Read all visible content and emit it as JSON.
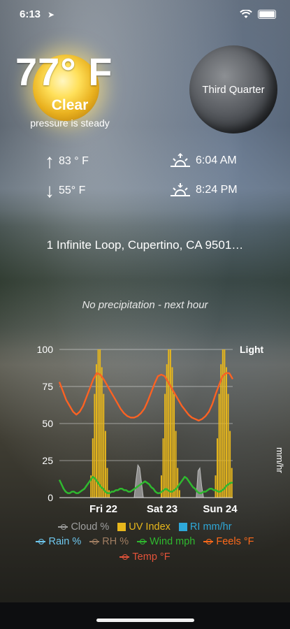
{
  "status_bar": {
    "time": "6:13",
    "location_icon": "arrow-icon",
    "wifi_icon": "wifi-icon",
    "battery_icon": "battery-icon"
  },
  "current": {
    "temperature": "77° F",
    "condition": "Clear",
    "pressure": "pressure is steady"
  },
  "moon": {
    "phase": "Third Quarter"
  },
  "high": {
    "value": "83 ° F"
  },
  "low": {
    "value": "55° F"
  },
  "sunrise": {
    "time": "6:04 AM"
  },
  "sunset": {
    "time": "8:24 PM"
  },
  "address": "1 Infinite Loop, Cupertino, CA 9501…",
  "precip_note": "No precipitation - next hour",
  "chart_data": {
    "type": "bar+line",
    "categories": [
      "Fri 22",
      "Sat 23",
      "Sun 24"
    ],
    "y_ticks": [
      0,
      25,
      50,
      75,
      100
    ],
    "ylim": [
      0,
      100
    ],
    "right_labels": {
      "top": "Light",
      "unit": "mm/hr"
    },
    "series": [
      {
        "name": "Cloud %",
        "type": "area",
        "color": "#a0a0a0",
        "values": [
          0,
          0,
          0,
          0,
          0,
          0,
          0,
          0,
          0,
          0,
          0,
          0,
          0,
          0,
          0,
          0,
          0,
          0,
          0,
          0,
          0,
          0,
          0,
          0,
          0,
          0,
          0,
          0,
          0,
          0,
          0,
          0,
          0,
          0,
          0,
          0,
          0,
          0,
          0,
          0,
          0,
          0,
          12,
          22,
          20,
          10,
          0,
          0,
          0,
          0,
          0,
          0,
          0,
          0,
          0,
          0,
          0,
          0,
          0,
          0,
          0,
          0,
          0,
          0,
          0,
          0,
          0,
          0,
          0,
          0,
          0,
          0,
          0,
          0,
          0,
          0,
          18,
          20,
          8,
          0,
          0,
          0,
          0,
          0,
          0,
          0,
          0,
          0,
          0,
          0,
          0,
          0,
          0,
          0,
          0,
          0
        ]
      },
      {
        "name": "UV Index",
        "type": "bar",
        "color": "#e8b71c",
        "values": [
          0,
          0,
          0,
          0,
          0,
          0,
          0,
          0,
          0,
          0,
          0,
          0,
          0,
          0,
          0,
          0,
          0,
          15,
          40,
          70,
          90,
          100,
          100,
          88,
          70,
          45,
          20,
          5,
          0,
          0,
          0,
          0,
          0,
          0,
          0,
          0,
          0,
          0,
          0,
          0,
          0,
          0,
          0,
          0,
          0,
          0,
          0,
          0,
          0,
          0,
          0,
          0,
          0,
          0,
          0,
          0,
          15,
          40,
          70,
          90,
          100,
          100,
          88,
          70,
          45,
          20,
          5,
          0,
          0,
          0,
          0,
          0,
          0,
          0,
          0,
          0,
          0,
          0,
          0,
          0,
          0,
          0,
          0,
          0,
          0,
          0,
          15,
          40,
          70,
          90,
          100,
          100,
          88,
          70,
          45,
          20
        ]
      },
      {
        "name": "RI mm/hr",
        "type": "bar",
        "color": "#2ea8d9",
        "values": [
          0
        ]
      },
      {
        "name": "Rain %",
        "type": "line",
        "color": "#6fc8ef",
        "values": [
          0
        ]
      },
      {
        "name": "RH %",
        "type": "line",
        "color": "#a07e62",
        "values": [
          0
        ]
      },
      {
        "name": "Wind mph",
        "type": "line",
        "color": "#2fb92f",
        "values": [
          12,
          9,
          6,
          4,
          3,
          3,
          4,
          4,
          3,
          3,
          4,
          5,
          6,
          8,
          10,
          12,
          14,
          13,
          11,
          9,
          7,
          6,
          4,
          3,
          3,
          4,
          4,
          5,
          5,
          6,
          6,
          5,
          5,
          4,
          4,
          5,
          6,
          7,
          8,
          9,
          10,
          11,
          10,
          9,
          7,
          6,
          4,
          3,
          3,
          4,
          5,
          6,
          5,
          4,
          4,
          5,
          6,
          8,
          10,
          12,
          14,
          13,
          11,
          9,
          7,
          6,
          4,
          3,
          3,
          4,
          4,
          5,
          6,
          6,
          5,
          5,
          4,
          4,
          5,
          6,
          8,
          9,
          10,
          10
        ]
      },
      {
        "name": "Feels °F",
        "type": "line",
        "color": "#ff6a1a",
        "values": [
          78,
          72,
          66,
          62,
          58,
          56,
          58,
          62,
          68,
          74,
          80,
          84,
          83,
          80,
          76,
          72,
          68,
          64,
          60,
          57,
          55,
          54,
          54,
          55,
          57,
          60,
          65,
          71,
          77,
          82,
          83,
          82,
          78,
          74,
          70,
          66,
          62,
          59,
          56,
          54,
          53,
          52,
          53,
          55,
          58,
          63,
          70,
          76,
          82,
          84,
          84,
          80
        ]
      },
      {
        "name": "Temp °F",
        "type": "line",
        "color": "#e5533a",
        "values": [
          78,
          72,
          66,
          62,
          58,
          56,
          58,
          62,
          68,
          74,
          80,
          84,
          83,
          80,
          76,
          72,
          68,
          64,
          60,
          57,
          55,
          54,
          54,
          55,
          57,
          60,
          65,
          71,
          77,
          82,
          83,
          82,
          78,
          74,
          70,
          66,
          62,
          59,
          56,
          54,
          53,
          52,
          53,
          55,
          58,
          63,
          70,
          76,
          82,
          84,
          84,
          80
        ]
      }
    ]
  },
  "legend_colors": {
    "cloud": "#a0a0a0",
    "uv": "#e8b71c",
    "ri": "#2ea8d9",
    "rain": "#6fc8ef",
    "rh": "#a07e62",
    "wind": "#2fb92f",
    "feels": "#ff6a1a",
    "temp": "#e5533a"
  }
}
